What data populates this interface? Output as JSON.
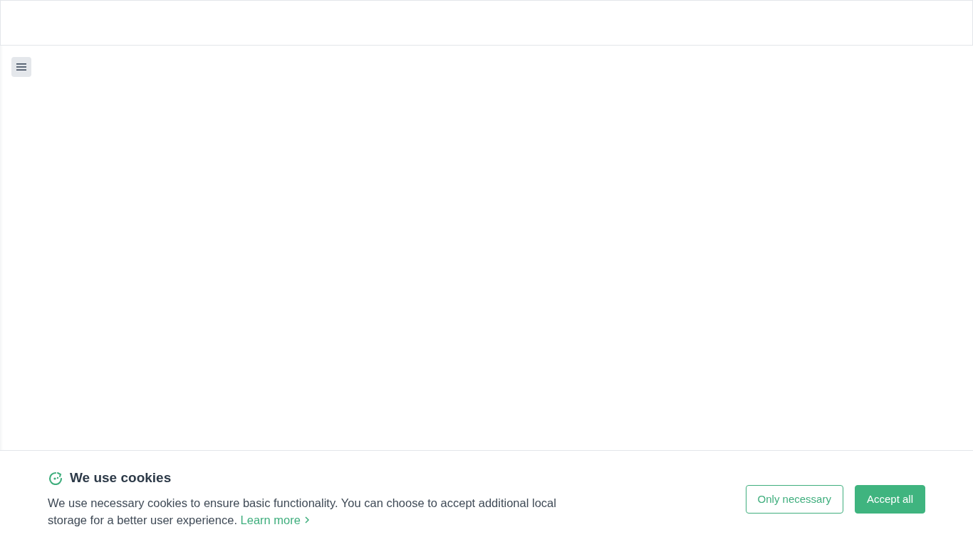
{
  "cookie_banner": {
    "title": "We use cookies",
    "message": "We use necessary cookies to ensure basic functionality. You can choose to accept additional local storage for a better user experience.",
    "link": "Learn more",
    "buttons": [
      {
        "label": "Only necessary",
        "kind": "outline"
      },
      {
        "label": "Accept all",
        "kind": "primary"
      }
    ]
  }
}
